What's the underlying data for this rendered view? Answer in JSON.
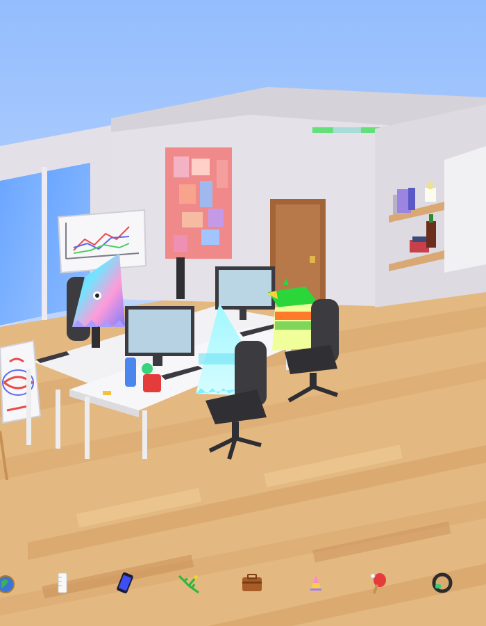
{
  "scene": {
    "sky_top": "#9fc6ff",
    "sky_bottom": "#dfe9ff",
    "wall": "#e6e3ea",
    "wall_shade": "#cfcbd4",
    "floor_light": "#e7bf8b",
    "floor_dark": "#d7a56c",
    "floor_stripe": "#c9935c",
    "door": "#a86a3b",
    "desk": "#f4f4f6",
    "chair": "#3b3b40",
    "monitor_screen": "#b9d6e6"
  },
  "characters": [
    {
      "id": "holo-hat",
      "colors": [
        "#b57cff",
        "#6fe0ff",
        "#ff9ad6"
      ]
    },
    {
      "id": "cyan-hat",
      "colors": [
        "#c8fbff",
        "#52e8ff"
      ]
    },
    {
      "id": "green-hat",
      "colors": [
        "#2bd63b",
        "#f1ff9a",
        "#ff7b2b"
      ]
    }
  ],
  "toolbar": {
    "items": [
      {
        "name": "globe-tool-icon"
      },
      {
        "name": "ruler-tool-icon"
      },
      {
        "name": "phone-tool-icon"
      },
      {
        "name": "branch-tool-icon"
      },
      {
        "name": "briefcase-tool-icon"
      },
      {
        "name": "party-hat-tool-icon"
      },
      {
        "name": "ping-pong-tool-icon"
      },
      {
        "name": "ring-tool-icon"
      }
    ]
  }
}
